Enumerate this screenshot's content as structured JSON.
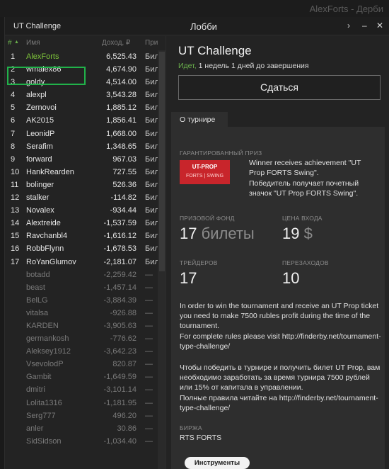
{
  "background_app": {
    "title": "AlexForts - Дерби"
  },
  "window": {
    "left_title": "UT Challenge",
    "center_title": "Лобби",
    "btn_next": "›",
    "btn_minimize": "–",
    "btn_close": "✕"
  },
  "table": {
    "columns": {
      "rank": "#",
      "sort_icon": "▲",
      "name": "Имя",
      "income": "Доход, ₽",
      "prize": "При"
    },
    "rows": [
      {
        "rank": "1",
        "name": "AlexForts",
        "value": "6,525.43",
        "status": "Бил"
      },
      {
        "rank": "2",
        "name": "wmalex86",
        "value": "4,674.90",
        "status": "Бил"
      },
      {
        "rank": "3",
        "name": "goldy",
        "value": "4,514.00",
        "status": "Бил"
      },
      {
        "rank": "4",
        "name": "alexpl",
        "value": "3,543.28",
        "status": "Бил"
      },
      {
        "rank": "5",
        "name": "Zernovoi",
        "value": "1,885.12",
        "status": "Бил"
      },
      {
        "rank": "6",
        "name": "AK2015",
        "value": "1,856.41",
        "status": "Бил"
      },
      {
        "rank": "7",
        "name": "LeonidP",
        "value": "1,668.00",
        "status": "Бил"
      },
      {
        "rank": "8",
        "name": "Serafim",
        "value": "1,348.65",
        "status": "Бил"
      },
      {
        "rank": "9",
        "name": "forward",
        "value": "967.03",
        "status": "Бил"
      },
      {
        "rank": "10",
        "name": "HankRearden",
        "value": "727.55",
        "status": "Бил"
      },
      {
        "rank": "11",
        "name": "bolinger",
        "value": "526.36",
        "status": "Бил"
      },
      {
        "rank": "12",
        "name": "stalker",
        "value": "-114.82",
        "status": "Бил"
      },
      {
        "rank": "13",
        "name": "Novalex",
        "value": "-934.44",
        "status": "Бил"
      },
      {
        "rank": "14",
        "name": "Alextreide",
        "value": "-1,537.59",
        "status": "Бил"
      },
      {
        "rank": "15",
        "name": "Ravchanbl4",
        "value": "-1,616.12",
        "status": "Бил"
      },
      {
        "rank": "16",
        "name": "RobbFlynn",
        "value": "-1,678.53",
        "status": "Бил"
      },
      {
        "rank": "17",
        "name": "RoYanGlumov",
        "value": "-2,181.07",
        "status": "Бил"
      },
      {
        "rank": "",
        "name": "botadd",
        "value": "-2,259.42",
        "status": "—"
      },
      {
        "rank": "",
        "name": "beast",
        "value": "-1,457.14",
        "status": "—"
      },
      {
        "rank": "",
        "name": "BelLG",
        "value": "-3,884.39",
        "status": "—"
      },
      {
        "rank": "",
        "name": "vitalsa",
        "value": "-926.88",
        "status": "—"
      },
      {
        "rank": "",
        "name": "KARDEN",
        "value": "-3,905.63",
        "status": "—"
      },
      {
        "rank": "",
        "name": "germankosh",
        "value": "-776.62",
        "status": "—"
      },
      {
        "rank": "",
        "name": "Aleksey1912",
        "value": "-3,642.23",
        "status": "—"
      },
      {
        "rank": "",
        "name": "VsevolodP",
        "value": "820.87",
        "status": "—"
      },
      {
        "rank": "",
        "name": "Gambit",
        "value": "-1,649.59",
        "status": "—"
      },
      {
        "rank": "",
        "name": "dmitri",
        "value": "-3,101.14",
        "status": "—"
      },
      {
        "rank": "",
        "name": "Lolita1316",
        "value": "-1,181.95",
        "status": "—"
      },
      {
        "rank": "",
        "name": "Serg777",
        "value": "496.20",
        "status": "—"
      },
      {
        "rank": "",
        "name": "anler",
        "value": "30.86",
        "status": "—"
      },
      {
        "rank": "",
        "name": "SidSidson",
        "value": "-1,034.40",
        "status": "—"
      }
    ]
  },
  "details": {
    "title": "UT Challenge",
    "status_live": "Идет,",
    "status_rest": " 1 недель 1 дней до завершения",
    "surrender_button": "Сдаться",
    "tab_label": "О турнире",
    "guaranteed_prize_label": "ГАРАНТИРОВАННЫЙ ПРИЗ",
    "ticket_line1": "UT-PROP",
    "ticket_line2": "FORTS | SWING",
    "prize_text_en": "Winner receives achievement \"UT Prop FORTS Swing\".",
    "prize_text_ru": "Победитель получает почетный значок \"UT Prop FORTS Swing\".",
    "prize_fund_label": "ПРИЗОВОЙ ФОНД",
    "prize_fund_value": "17",
    "prize_fund_unit": "билеты",
    "entry_fee_label": "ЦЕНА ВХОДА",
    "entry_fee_value": "19",
    "entry_fee_unit": "$",
    "traders_label": "ТРЕЙДЕРОВ",
    "traders_value": "17",
    "reentries_label": "ПЕРЕЗАХОДОВ",
    "reentries_value": "10",
    "desc_en": "In order to win the tournament and receive an UT Prop ticket you need to make 7500 rubles profit during the time of the tournament.",
    "rules_en": "For complete rules please visit http://finderby.net/tournament-type-challenge/",
    "desc_ru": "Чтобы победить в турнире и получить билет UT Prop, вам необходимо заработать за время турнира 7500 рублей или 15% от капитала в управлении.",
    "rules_ru": "Полные правила читайте на http://finderby.net/tournament-type-challenge/",
    "exchange_label": "БИРЖА",
    "exchange_value": "RTS FORTS",
    "instruments_button": "Инструменты"
  },
  "colors": {
    "accent_green": "#6ab04c",
    "highlight_box": "#21b24a",
    "ticket_red": "#c8252b"
  }
}
